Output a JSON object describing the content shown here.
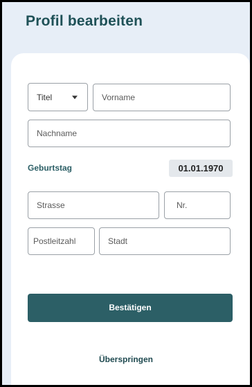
{
  "header": {
    "title": "Profil bearbeiten"
  },
  "form": {
    "title_select": {
      "value": "Titel",
      "icon": "caret-down-icon"
    },
    "first_name": {
      "placeholder": "Vorname"
    },
    "last_name": {
      "placeholder": "Nachname"
    },
    "birthday": {
      "label": "Geburtstag",
      "value": "01.01.1970"
    },
    "street": {
      "placeholder": "Strasse"
    },
    "house_number": {
      "placeholder": "Nr."
    },
    "postal_code": {
      "placeholder": "Postleitzahl"
    },
    "city": {
      "placeholder": "Stadt"
    }
  },
  "actions": {
    "confirm_label": "Bestätigen",
    "skip_label": "Überspringen"
  },
  "colors": {
    "accent": "#2c5f66",
    "header_bg": "#e7eef7",
    "title_text": "#1f5157"
  }
}
